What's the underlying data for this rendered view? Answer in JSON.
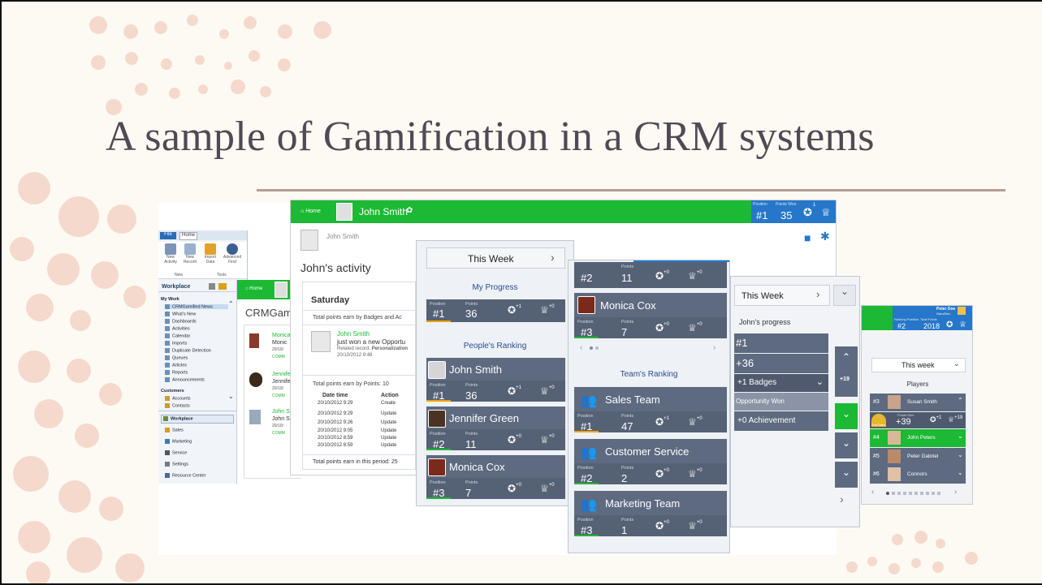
{
  "slide": {
    "title": "A sample of Gamification in a CRM systems"
  },
  "crm_window": {
    "ribbon_tabs": [
      "File",
      "Home"
    ],
    "ribbon_buttons": [
      "New Activity",
      "New Record",
      "Import Data",
      "Advanced Find"
    ],
    "ribbon_groups": [
      "New",
      "Tools"
    ],
    "nav_title": "Workplace",
    "my_work_header": "My Work",
    "my_work_items": [
      "CRMGamified News",
      "What's New",
      "Dashboards",
      "Activities",
      "Calendar",
      "Imports",
      "Duplicate Detection",
      "Queues",
      "Articles",
      "Reports",
      "Announcements"
    ],
    "customers_header": "Customers",
    "customers_items": [
      "Accounts",
      "Contacts"
    ],
    "areas": [
      "Workplace",
      "Sales",
      "Marketing",
      "Service",
      "Settings",
      "Resource Center"
    ],
    "inner_home": "Home",
    "inner_title": "CRMGamif",
    "feed": [
      {
        "name": "Monica",
        "line": "Monic",
        "date": "20/10/",
        "tag": "COMM"
      },
      {
        "name": "Jennifer",
        "line": "Jennife",
        "date": "20/10/",
        "tag": "COMM"
      },
      {
        "name": "John S",
        "line": "John S",
        "date": "20/10/",
        "tag": "COMM"
      }
    ]
  },
  "activity_window": {
    "home": "Home",
    "user": "John Smith",
    "header_position_label": "Position",
    "header_position": "#1",
    "header_points_label": "Points Won",
    "header_points": "35",
    "header_badge_count": "1",
    "breadcrumb_user": "John Smith",
    "title": "John's activity",
    "day": "Saturday",
    "summary_badges": "Total points earn by Badges and Ac",
    "activity_name": "John Smith",
    "activity_text": "just won a new Opportu",
    "activity_related_label": "Related record:",
    "activity_related_value": "Personalization",
    "activity_date": "20/10/2012 9:48",
    "summary_points": "Total points earn by Points: 10",
    "table_headers": [
      "Date time",
      "Action"
    ],
    "table_rows": [
      [
        "20/10/2012 9:29",
        "Create"
      ],
      [
        "20/10/2012 9:29",
        "Update"
      ],
      [
        "20/10/2012 9:26",
        "Update"
      ],
      [
        "20/10/2012 9:05",
        "Update"
      ],
      [
        "20/10/2012 8:59",
        "Update"
      ],
      [
        "20/10/2012 8:59",
        "Update"
      ]
    ],
    "period_total": "Total points earn in this period: 25"
  },
  "progress_panel": {
    "period": "This Week",
    "my_progress_label": "My Progress",
    "my_position_label": "Position",
    "my_position": "#1",
    "my_points_label": "Points",
    "my_points": "36",
    "badge_plus": "+1",
    "trophy_plus": "+0",
    "ranking_label": "People's Ranking",
    "people": [
      {
        "name": "John Smith",
        "position": "#1",
        "points": "36",
        "badge": "+1",
        "trophy": "+0",
        "accent": "#f0a400"
      },
      {
        "name": "Jennifer Green",
        "position": "#2",
        "points": "11",
        "badge": "+0",
        "trophy": "+0",
        "accent": "#1cb934"
      },
      {
        "name": "Monica Cox",
        "position": "#3",
        "points": "7",
        "badge": "+0",
        "trophy": "+0",
        "accent": "#1cb934"
      }
    ]
  },
  "team_panel": {
    "top_partial": {
      "position": "#2",
      "points": "11",
      "badge": "+0",
      "trophy": "+0"
    },
    "person": {
      "name": "Monica Cox",
      "position": "#3",
      "points": "7",
      "badge": "+0",
      "trophy": "+0"
    },
    "position_label": "Position",
    "points_label": "Points",
    "ranking_label": "Team's Ranking",
    "teams": [
      {
        "name": "Sales Team",
        "position": "#1",
        "points": "47",
        "badge": "+1",
        "trophy": "+0",
        "accent": "#f0a400"
      },
      {
        "name": "Customer Service",
        "position": "#2",
        "points": "2",
        "badge": "+0",
        "trophy": "+0",
        "accent": "#1cb934"
      },
      {
        "name": "Marketing Team",
        "position": "#3",
        "points": "1",
        "badge": "+0",
        "trophy": "+0",
        "accent": "#1cb934"
      }
    ]
  },
  "johns_progress_panel": {
    "period": "This Week",
    "label": "John's progress",
    "rows": [
      "#1",
      "+36",
      "+1 Badges",
      "Opportunity Won",
      "+0 Achievement"
    ],
    "side_count": "+19"
  },
  "players_panel": {
    "user": "Peter Doe",
    "user_team": "Gam/Dev",
    "rank_label": "Ranking Position",
    "rank": "#2",
    "total_label": "Total Points",
    "total": "2018",
    "period": "This week",
    "players_label": "Players",
    "players": [
      {
        "rank": "#3",
        "name": "Susan Smith"
      },
      {
        "rank": "#4",
        "name": "John Peters"
      },
      {
        "rank": "#5",
        "name": "Peter Gabriel"
      },
      {
        "rank": "#6",
        "name": "Connors"
      }
    ],
    "points_won_label": "Points Won",
    "points_won": "+39",
    "badge_plus": "+1",
    "trophy_plus": "+19",
    "level_label": "Pure Sales"
  },
  "colors": {
    "crm_green": "#1cb934",
    "crm_blue": "#2677c9",
    "card": "#5e6a80",
    "title": "#504a55",
    "rule": "#b79d94"
  }
}
